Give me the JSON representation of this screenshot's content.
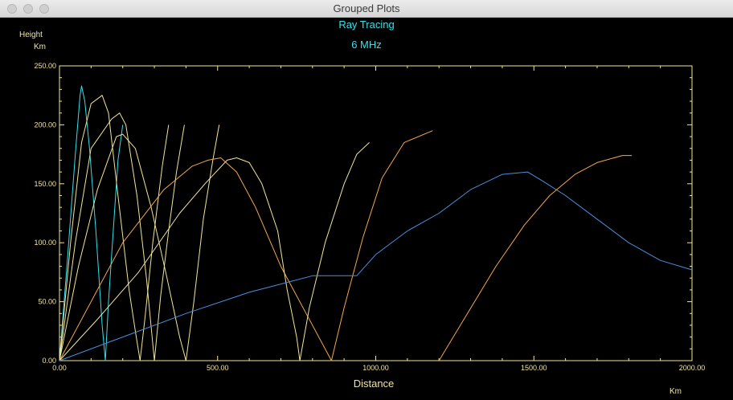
{
  "window": {
    "title": "Grouped Plots"
  },
  "chart_data": {
    "type": "line",
    "title": "Ray Tracing",
    "subtitle": "6 MHz",
    "ylabel": "Height",
    "yunit": "Km",
    "xlabel": "Distance",
    "xunit": "Km",
    "xlim": [
      0,
      2000
    ],
    "ylim": [
      0,
      250
    ],
    "xticks": [
      "0.00",
      "500.00",
      "1000.00",
      "1500.00",
      "2000.00"
    ],
    "yticks": [
      "0.00",
      "50.00",
      "100.00",
      "150.00",
      "200.00",
      "250.00"
    ],
    "series": [
      {
        "color": "#33e1ea",
        "points": [
          [
            0,
            0
          ],
          [
            25,
            85
          ],
          [
            50,
            175
          ],
          [
            65,
            225
          ],
          [
            70,
            233
          ],
          [
            80,
            220
          ],
          [
            95,
            180
          ],
          [
            115,
            110
          ],
          [
            135,
            30
          ],
          [
            145,
            0
          ],
          [
            155,
            50
          ],
          [
            170,
            110
          ],
          [
            185,
            170
          ],
          [
            200,
            200
          ]
        ]
      },
      {
        "color": "#f3e59a",
        "points": [
          [
            0,
            0
          ],
          [
            35,
            100
          ],
          [
            70,
            185
          ],
          [
            100,
            218
          ],
          [
            135,
            225
          ],
          [
            155,
            210
          ],
          [
            185,
            140
          ],
          [
            220,
            60
          ],
          [
            240,
            25
          ],
          [
            255,
            0
          ],
          [
            270,
            35
          ],
          [
            295,
            100
          ],
          [
            325,
            165
          ],
          [
            345,
            200
          ]
        ]
      },
      {
        "color": "#f3e59a",
        "points": [
          [
            0,
            0
          ],
          [
            50,
            100
          ],
          [
            100,
            180
          ],
          [
            165,
            205
          ],
          [
            190,
            210
          ],
          [
            210,
            200
          ],
          [
            245,
            140
          ],
          [
            275,
            70
          ],
          [
            300,
            0
          ],
          [
            320,
            55
          ],
          [
            345,
            110
          ],
          [
            370,
            160
          ],
          [
            395,
            200
          ]
        ]
      },
      {
        "color": "#f3e59a",
        "points": [
          [
            0,
            0
          ],
          [
            60,
            80
          ],
          [
            120,
            145
          ],
          [
            180,
            190
          ],
          [
            200,
            192
          ],
          [
            240,
            180
          ],
          [
            290,
            130
          ],
          [
            340,
            70
          ],
          [
            380,
            20
          ],
          [
            400,
            0
          ],
          [
            425,
            50
          ],
          [
            455,
            120
          ],
          [
            485,
            170
          ],
          [
            505,
            200
          ]
        ]
      },
      {
        "color": "#f3a84a",
        "points": [
          [
            0,
            0
          ],
          [
            100,
            50
          ],
          [
            200,
            100
          ],
          [
            330,
            145
          ],
          [
            420,
            165
          ],
          [
            470,
            170
          ],
          [
            510,
            172
          ],
          [
            560,
            160
          ],
          [
            620,
            130
          ],
          [
            700,
            80
          ],
          [
            780,
            40
          ],
          [
            860,
            0
          ],
          [
            900,
            45
          ],
          [
            960,
            105
          ],
          [
            1020,
            155
          ],
          [
            1090,
            185
          ],
          [
            1180,
            195
          ]
        ]
      },
      {
        "color": "#f3e59a",
        "points": [
          [
            0,
            0
          ],
          [
            120,
            35
          ],
          [
            250,
            75
          ],
          [
            380,
            125
          ],
          [
            460,
            150
          ],
          [
            530,
            170
          ],
          [
            560,
            172
          ],
          [
            600,
            168
          ],
          [
            640,
            150
          ],
          [
            690,
            110
          ],
          [
            720,
            60
          ],
          [
            750,
            20
          ],
          [
            760,
            0
          ],
          [
            790,
            45
          ],
          [
            840,
            100
          ],
          [
            900,
            150
          ],
          [
            940,
            175
          ],
          [
            980,
            185
          ]
        ]
      },
      {
        "color": "#4a8fe0",
        "points": [
          [
            0,
            0
          ],
          [
            200,
            20
          ],
          [
            400,
            40
          ],
          [
            600,
            58
          ],
          [
            800,
            72
          ],
          [
            940,
            72
          ],
          [
            1000,
            90
          ],
          [
            1100,
            110
          ],
          [
            1200,
            125
          ],
          [
            1300,
            145
          ],
          [
            1400,
            158
          ],
          [
            1480,
            160
          ],
          [
            1530,
            152
          ],
          [
            1600,
            140
          ],
          [
            1700,
            120
          ],
          [
            1800,
            100
          ],
          [
            1900,
            85
          ],
          [
            2000,
            77
          ]
        ]
      },
      {
        "color": "#f3a84a",
        "points": [
          [
            1200,
            0
          ],
          [
            1290,
            40
          ],
          [
            1380,
            80
          ],
          [
            1470,
            115
          ],
          [
            1550,
            140
          ],
          [
            1630,
            158
          ],
          [
            1700,
            168
          ],
          [
            1780,
            174
          ],
          [
            1810,
            174
          ]
        ]
      }
    ]
  }
}
